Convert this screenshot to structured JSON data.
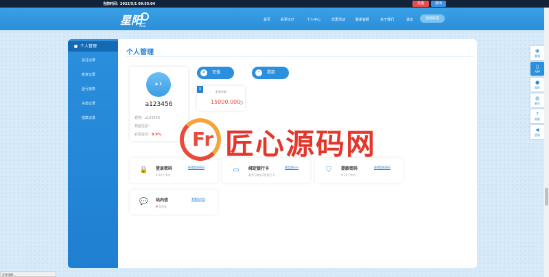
{
  "topbar": {
    "time_label": "当前时间：2022/5/1 09:55:04",
    "recharge_label": "充值",
    "logout_label": "退出"
  },
  "header": {
    "logo_text": "星阳",
    "logo_sub": "XING YANG",
    "nav": [
      "首页",
      "彩票大厅",
      "个人中心",
      "优惠活动",
      "联系客服",
      "关于我们",
      "退出"
    ],
    "nav_pill": "活动彩票"
  },
  "sidebar": {
    "active": "个人管理",
    "items": [
      "投注记录",
      "帐变记录",
      "盈亏报表",
      "充值记录",
      "提款记录"
    ]
  },
  "main": {
    "title": "个人管理",
    "profile": {
      "avatar_text": "a 1",
      "username": "a123456",
      "nickname": "昵称：a123456",
      "tip": "预留信息：",
      "rebate_label": "彩票返点：",
      "rebate_value": "9.9%"
    },
    "actions": {
      "recharge": "充值",
      "withdraw": "提款"
    },
    "balance": {
      "tag": "币",
      "label": "彩票余额",
      "value": "15000.000"
    },
    "security": [
      {
        "title": "登录密码",
        "sub": "6-16个字符",
        "link": "修改登录密码",
        "icon": "lock-icon"
      },
      {
        "title": "绑定银行卡",
        "sub": "最多可绑定2张银行卡",
        "link": "绑定银行卡",
        "icon": "card-icon"
      },
      {
        "title": "提款密码",
        "sub": "6-16个字符",
        "link": "修改提款密码",
        "icon": "shield-icon"
      },
      {
        "title": "站内信",
        "sub_count": "0",
        "sub": "条未读",
        "link": "查看站内信",
        "icon": "message-icon"
      }
    ]
  },
  "watermark": {
    "mark": "Fr",
    "text": "匠心源码网"
  },
  "rightbar": [
    {
      "label": "客服",
      "icon": "eye-icon"
    },
    {
      "label": "APP",
      "icon": "phone-icon"
    },
    {
      "label": "我的",
      "icon": "user-icon"
    },
    {
      "label": "聊天",
      "icon": "chat-icon"
    },
    {
      "label": "帮助",
      "icon": "help-icon"
    },
    {
      "label": "音效",
      "icon": "sound-icon"
    }
  ],
  "statusbar": {
    "text": "正在连接…"
  }
}
